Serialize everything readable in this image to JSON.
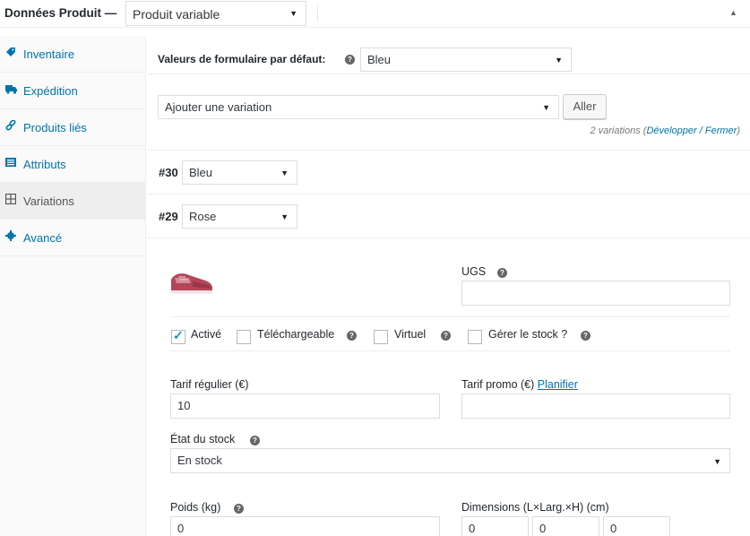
{
  "header": {
    "title": "Données Produit —",
    "product_type": "Produit variable"
  },
  "sidebar": {
    "items": [
      {
        "label": "Inventaire",
        "icon": "tag-icon"
      },
      {
        "label": "Expédition",
        "icon": "truck-icon"
      },
      {
        "label": "Produits liés",
        "icon": "link-icon"
      },
      {
        "label": "Attributs",
        "icon": "list-icon"
      },
      {
        "label": "Variations",
        "icon": "grid-icon"
      },
      {
        "label": "Avancé",
        "icon": "gear-icon"
      }
    ],
    "active_index": 4
  },
  "defaults": {
    "label": "Valeurs de formulaire par défaut:",
    "value": "Bleu"
  },
  "add_variation": {
    "select_value": "Ajouter une variation",
    "button_label": "Aller",
    "count_text": "2 variations (",
    "expand_label": "Développer",
    "sep": " / ",
    "close_label": "Fermer",
    "close_paren": ")"
  },
  "variations": [
    {
      "id": "#30",
      "value": "Bleu"
    },
    {
      "id": "#29",
      "value": "Rose"
    }
  ],
  "variation_detail": {
    "sku_label": "UGS",
    "sku_value": "",
    "checkboxes": [
      {
        "label": "Activé",
        "checked": true
      },
      {
        "label": "Téléchargeable",
        "checked": false
      },
      {
        "label": "Virtuel",
        "checked": false
      },
      {
        "label": "Gérer le stock ?",
        "checked": false
      }
    ],
    "regular_price_label": "Tarif régulier (€)",
    "regular_price_value": "10",
    "sale_price_label": "Tarif promo (€)",
    "schedule_link": "Planifier",
    "sale_price_value": "",
    "stock_status_label": "État du stock",
    "stock_status_value": "En stock",
    "weight_label": "Poids (kg)",
    "weight_value": "0",
    "dimensions_label": "Dimensions (L×Larg.×H) (cm)",
    "dimensions": [
      "0",
      "0",
      "0"
    ]
  },
  "colors": {
    "link": "#0073aa",
    "checkbox_check": "#1e8cbe",
    "active_tab_bg": "#eeeeee"
  }
}
